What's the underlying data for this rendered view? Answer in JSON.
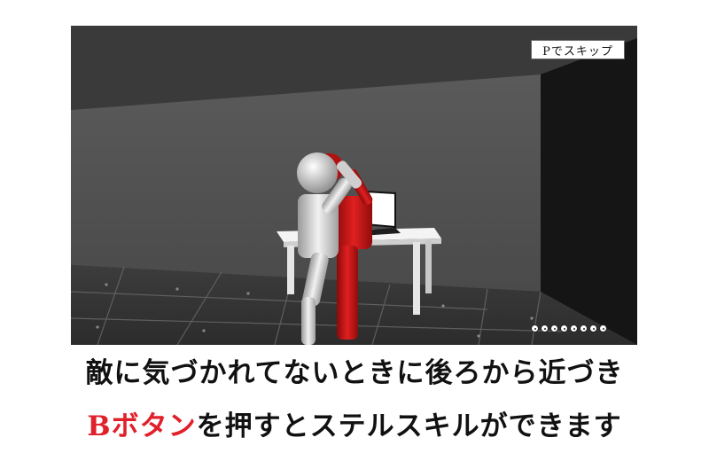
{
  "game": {
    "skip_hint": "Pでスキップ",
    "hud_dot_count": 8
  },
  "caption": {
    "line1": "敵に気づかれてないときに後ろから近づき",
    "line2_highlight": "Bボタン",
    "line2_rest": "を押すとステルスキルができます"
  },
  "colors": {
    "highlight": "#e0202a",
    "enemy": "#d01818",
    "player": "#e8e8e8",
    "floor": "#3a3a3a",
    "wall": "#555555"
  }
}
